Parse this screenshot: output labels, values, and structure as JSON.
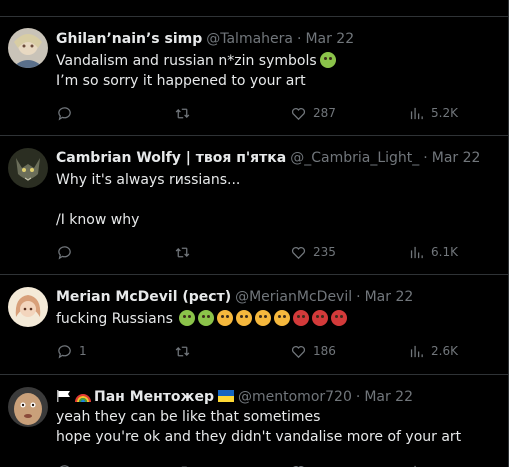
{
  "colors": {
    "background": "#000000",
    "divider": "#2f3336",
    "text_primary": "#e7e9ea",
    "text_secondary": "#71767b"
  },
  "tweets": [
    {
      "name": "Ghilan’nain’s simp",
      "handle": "@Talmahera",
      "separator": "·",
      "date": "Mar 22",
      "lines": [
        "Vandalism and russian n*zin symbols",
        "I’m so sorry it happened to your art"
      ],
      "emojis": [
        "nauseated-face"
      ],
      "actions": {
        "reply": "",
        "retweet": "",
        "like": "287",
        "views": "5.2K"
      }
    },
    {
      "name": "Cambrian Wolfy | твоя п'ятка",
      "handle": "@_Cambria_Light_",
      "separator": "·",
      "date": "Mar 22",
      "lines": [
        "Why it's always rиssians...",
        "",
        "/I know why"
      ],
      "emojis": [],
      "actions": {
        "reply": "",
        "retweet": "",
        "like": "235",
        "views": "6.1K"
      }
    },
    {
      "name": "Merian McDevil (рест)",
      "handle": "@MerianMcDevil",
      "separator": "·",
      "date": "Mar 22",
      "lines": [
        "fucking Russians"
      ],
      "emojis": [
        "nauseated-face",
        "nauseated-face",
        "vomiting-face",
        "vomiting-face",
        "vomiting-face",
        "vomiting-face",
        "cursing-face",
        "cursing-face",
        "cursing-face"
      ],
      "actions": {
        "reply": "1",
        "retweet": "",
        "like": "186",
        "views": "2.6K"
      }
    },
    {
      "name": "Пан Ментожер",
      "handle": "@mentomor720",
      "separator": "·",
      "date": "Mar 22",
      "lines": [
        "yeah they can be like that sometimes",
        "hope you're ok and they didn't vandalise more of your art"
      ],
      "name_prefix_icons": [
        "white-flag-icon",
        "rainbow-icon"
      ],
      "name_suffix_icons": [
        "ukraine-flag-icon"
      ],
      "actions": {
        "reply": "",
        "retweet": "",
        "like": "",
        "views": ""
      }
    }
  ]
}
